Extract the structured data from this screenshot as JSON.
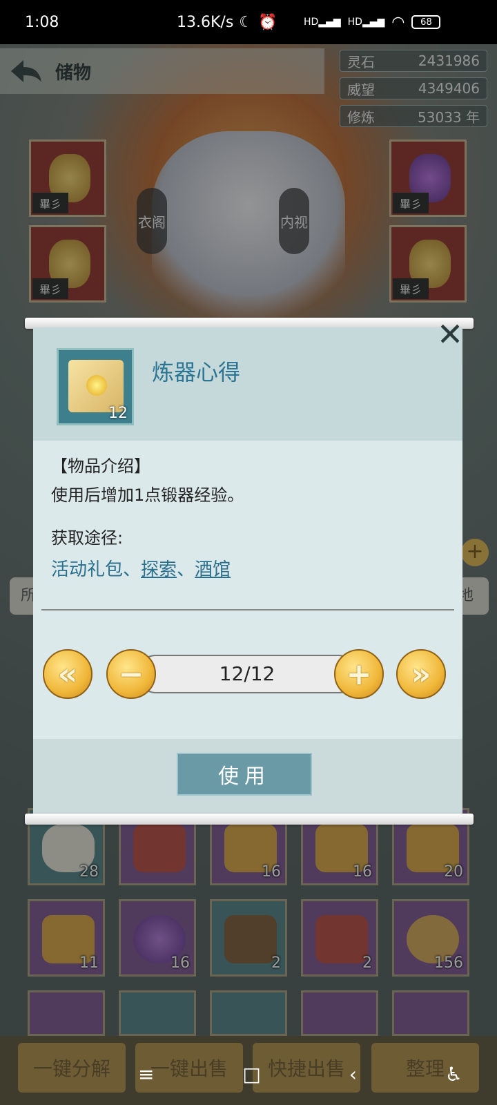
{
  "status_bar": {
    "time": "1:08",
    "speed": "13.6K/s",
    "hd1": "HD",
    "hd2": "HD",
    "battery": "68"
  },
  "header": {
    "title": "储物"
  },
  "stats": [
    {
      "label": "灵石",
      "value": "2431986"
    },
    {
      "label": "威望",
      "value": "4349406"
    },
    {
      "label": "修炼",
      "value": "53033 年"
    }
  ],
  "character": {
    "left_label": "衣阁",
    "right_label": "内视"
  },
  "equipment_tag": "畢彡",
  "inventory": {
    "row1_counts": [
      "28",
      "",
      "16",
      "16",
      "20"
    ],
    "row2_counts": [
      "11",
      "16",
      "2",
      "2",
      "156"
    ]
  },
  "dialog": {
    "item_name": "炼器心得",
    "item_qty": "12",
    "desc_heading": "【物品介绍】",
    "desc_text": "使用后增加1点锻器经验。",
    "source_label": "获取途径:",
    "source_plain": "活动礼包、",
    "source_link1": "探索",
    "source_sep": "、",
    "source_link2": "酒馆",
    "stepper_value": "12/12",
    "use_label": "使用",
    "close_glyph": "✕"
  },
  "bottom_buttons": [
    "一键分解",
    "一键出售",
    "快捷出售",
    "整理"
  ],
  "side_partial": {
    "left": "所",
    "right": "地"
  }
}
